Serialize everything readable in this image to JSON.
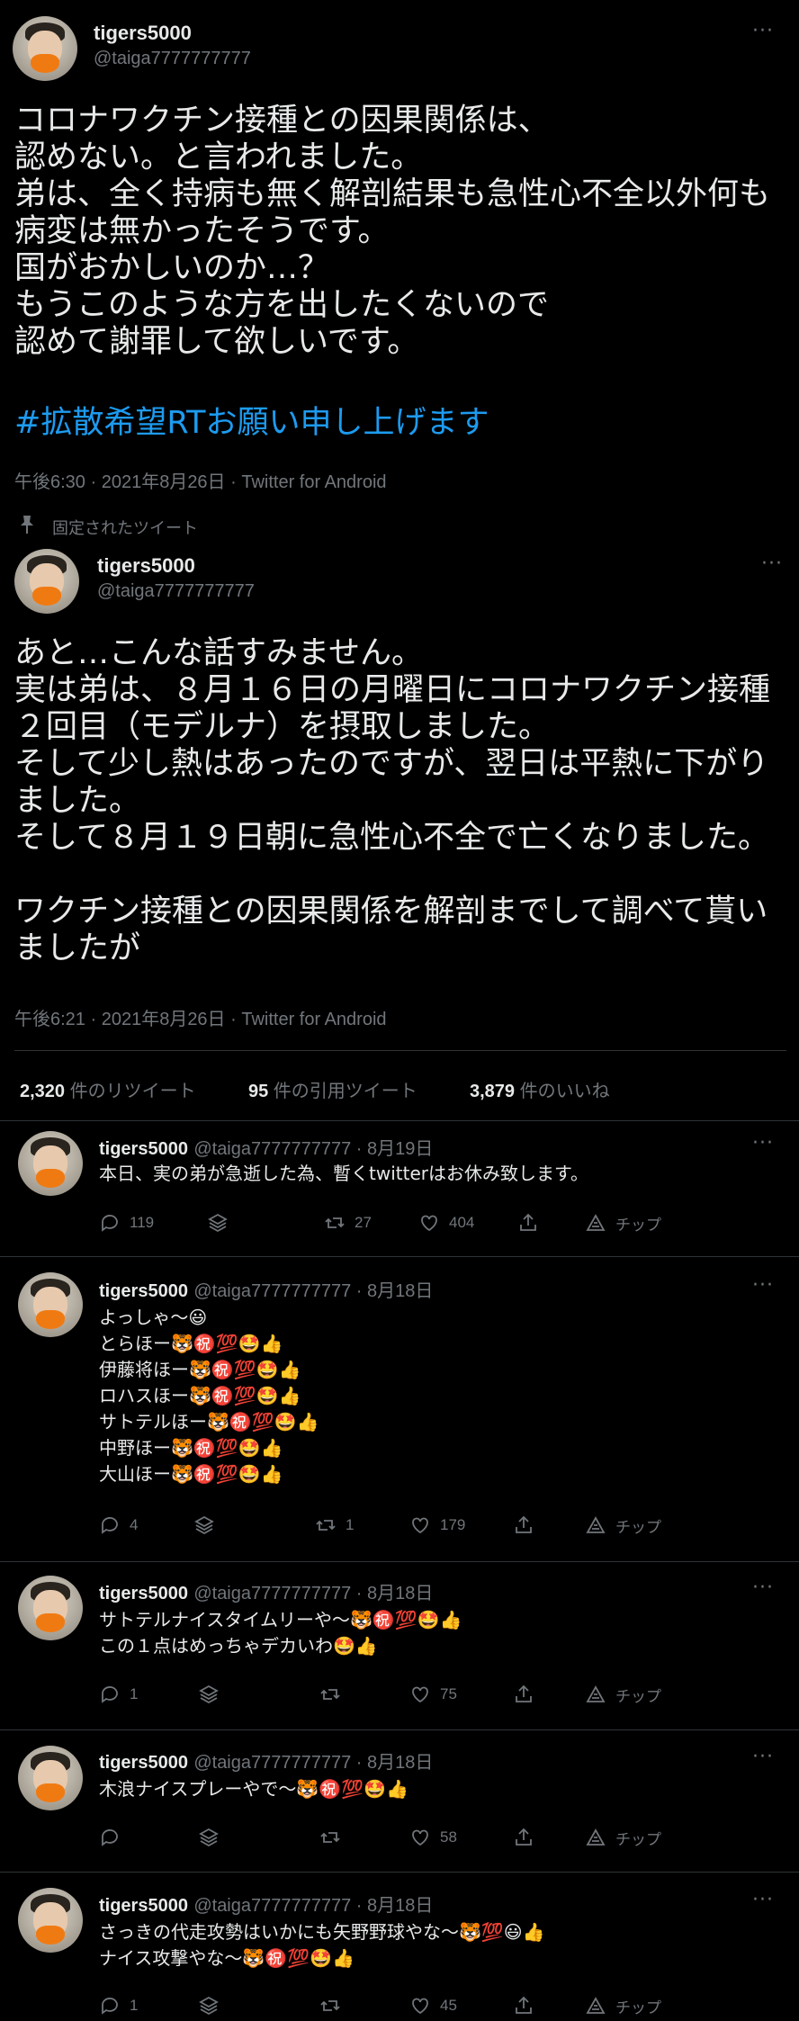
{
  "colors": {
    "background": "#000000",
    "text": "#e7e9ea",
    "secondary": "#71767b",
    "link": "#1d9bf0",
    "divider": "#2f3336",
    "avatar_mask": "#f07a12"
  },
  "top_tweet": {
    "name": "tigers5000",
    "handle": "@taiga7777777777",
    "more": "···",
    "text": "コロナワクチン接種との因果関係は、\n認めない。と言われました。\n弟は、全く持病も無く解剖結果も急性心不全以外何も\n病変は無かったそうです。\n国がおかしいのか…？\nもうこのような方を出したくないので\n認めて謝罪して欲しいです。",
    "hashtag": "#拡散希望RTお願い申し上げます",
    "meta": "午後6:30 · 2021年8月26日 · Twitter for Android"
  },
  "pinned": {
    "label": "固定されたツイート",
    "name": "tigers5000",
    "handle": "@taiga7777777777",
    "more": "···",
    "text": "あと…こんな話すみません。\n実は弟は、８月１６日の月曜日にコロナワクチン接種\n２回目（モデルナ）を摂取しました。\nそして少し熱はあったのですが、翌日は平熱に下がり\nました。\nそして８月１９日朝に急性心不全で亡くなりました。\n\nワクチン接種との因果関係を解剖までして調べて貰い\nましたが",
    "meta": "午後6:21 · 2021年8月26日 · Twitter for Android",
    "stats": [
      {
        "count": "2,320",
        "label": " 件のリツイート"
      },
      {
        "count": "95",
        "label": " 件の引用ツイート"
      },
      {
        "count": "3,879",
        "label": " 件のいいね"
      }
    ]
  },
  "replies": [
    {
      "name": "tigers5000",
      "handle": "@taiga7777777777 · 8月19日",
      "more": "···",
      "text": "本日、実の弟が急逝した為、暫くtwitterはお休み致します。",
      "reply": "119",
      "retweet": "27",
      "like": "404",
      "tip": "チップ"
    },
    {
      "name": "tigers5000",
      "handle": "@taiga7777777777 · 8月18日",
      "more": "···",
      "text": "よっしゃ〜😃\nとらほー🐯㊗️💯🤩👍\n伊藤将ほー🐯㊗️💯🤩👍\nロハスほー🐯㊗️💯🤩👍\nサトテルほー🐯㊗️💯🤩👍\n中野ほー🐯㊗️💯🤩👍\n大山ほー🐯㊗️💯🤩👍",
      "reply": "4",
      "retweet": "1",
      "like": "179",
      "tip": "チップ"
    },
    {
      "name": "tigers5000",
      "handle": "@taiga7777777777 · 8月18日",
      "more": "···",
      "text": "サトテルナイスタイムリーや〜🐯㊗️💯🤩👍\nこの１点はめっちゃデカいわ🤩👍",
      "reply": "1",
      "retweet": "",
      "like": "75",
      "tip": "チップ"
    },
    {
      "name": "tigers5000",
      "handle": "@taiga7777777777 · 8月18日",
      "more": "···",
      "text": "木浪ナイスプレーやで〜🐯㊗️💯🤩👍",
      "reply": "",
      "retweet": "",
      "like": "58",
      "tip": "チップ"
    },
    {
      "name": "tigers5000",
      "handle": "@taiga7777777777 · 8月18日",
      "more": "···",
      "text": "さっきの代走攻勢はいかにも矢野野球やな〜🐯💯😃👍\nナイス攻撃やな〜🐯㊗️💯🤩👍",
      "reply": "1",
      "retweet": "",
      "like": "45",
      "tip": "チップ"
    }
  ]
}
